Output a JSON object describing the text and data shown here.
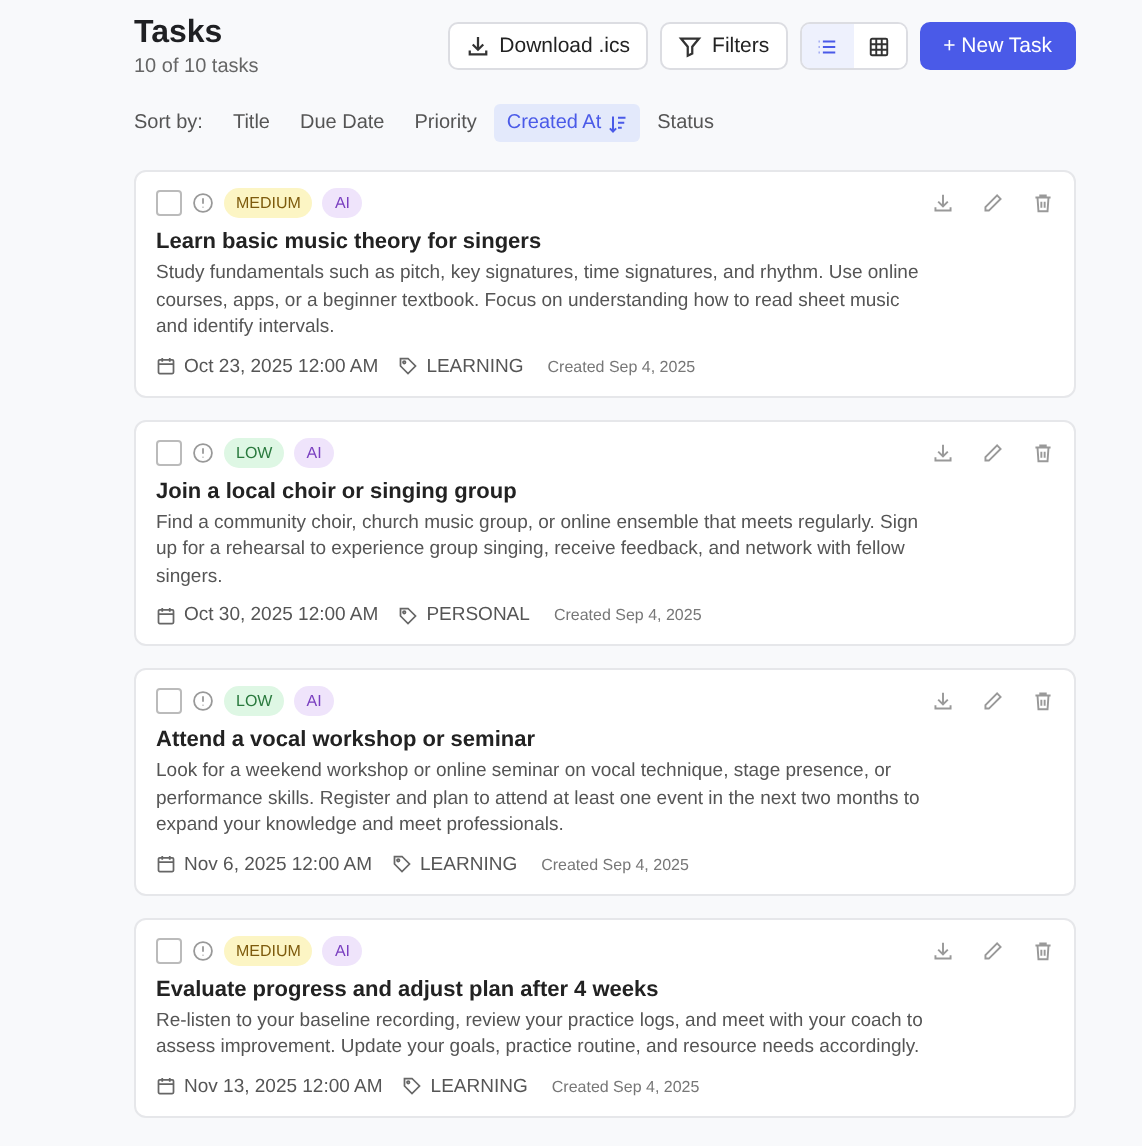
{
  "header": {
    "title": "Tasks",
    "count": "10 of 10 tasks"
  },
  "toolbar": {
    "download": "Download .ics",
    "filters": "Filters",
    "views": [
      {
        "kind": "list",
        "selected": true
      },
      {
        "kind": "grid",
        "selected": false
      }
    ],
    "new_task": "+ New Task"
  },
  "sort": {
    "label": "Sort by:",
    "options": [
      {
        "label": "Title",
        "selected": false
      },
      {
        "label": "Due Date",
        "selected": false
      },
      {
        "label": "Priority",
        "selected": false
      },
      {
        "label": "Created At",
        "selected": true
      },
      {
        "label": "Status",
        "selected": false
      }
    ]
  },
  "tasks": [
    {
      "checked": false,
      "priority": "MEDIUM",
      "kind": "medium",
      "ai": "AI",
      "title": "Learn basic music theory for singers",
      "description": "Study fundamentals such as pitch, key signatures, time signatures, and rhythm. Use online courses, apps, or a beginner textbook. Focus on understanding how to read sheet music and identify intervals.",
      "due": "Oct 23, 2025 12:00 AM",
      "tag": "LEARNING",
      "created": "Created Sep 4, 2025"
    },
    {
      "checked": false,
      "priority": "LOW",
      "kind": "low",
      "ai": "AI",
      "title": "Join a local choir or singing group",
      "description": "Find a community choir, church music group, or online ensemble that meets regularly. Sign up for a rehearsal to experience group singing, receive feedback, and network with fellow singers.",
      "due": "Oct 30, 2025 12:00 AM",
      "tag": "PERSONAL",
      "created": "Created Sep 4, 2025"
    },
    {
      "checked": false,
      "priority": "LOW",
      "kind": "low",
      "ai": "AI",
      "title": "Attend a vocal workshop or seminar",
      "description": "Look for a weekend workshop or online seminar on vocal technique, stage presence, or performance skills. Register and plan to attend at least one event in the next two months to expand your knowledge and meet professionals.",
      "due": "Nov 6, 2025 12:00 AM",
      "tag": "LEARNING",
      "created": "Created Sep 4, 2025"
    },
    {
      "checked": false,
      "priority": "MEDIUM",
      "kind": "medium",
      "ai": "AI",
      "title": "Evaluate progress and adjust plan after 4 weeks",
      "description": "Re-listen to your baseline recording, review your practice logs, and meet with your coach to assess improvement. Update your goals, practice routine, and resource needs accordingly.",
      "due": "Nov 13, 2025 12:00 AM",
      "tag": "LEARNING",
      "created": "Created Sep 4, 2025"
    }
  ]
}
